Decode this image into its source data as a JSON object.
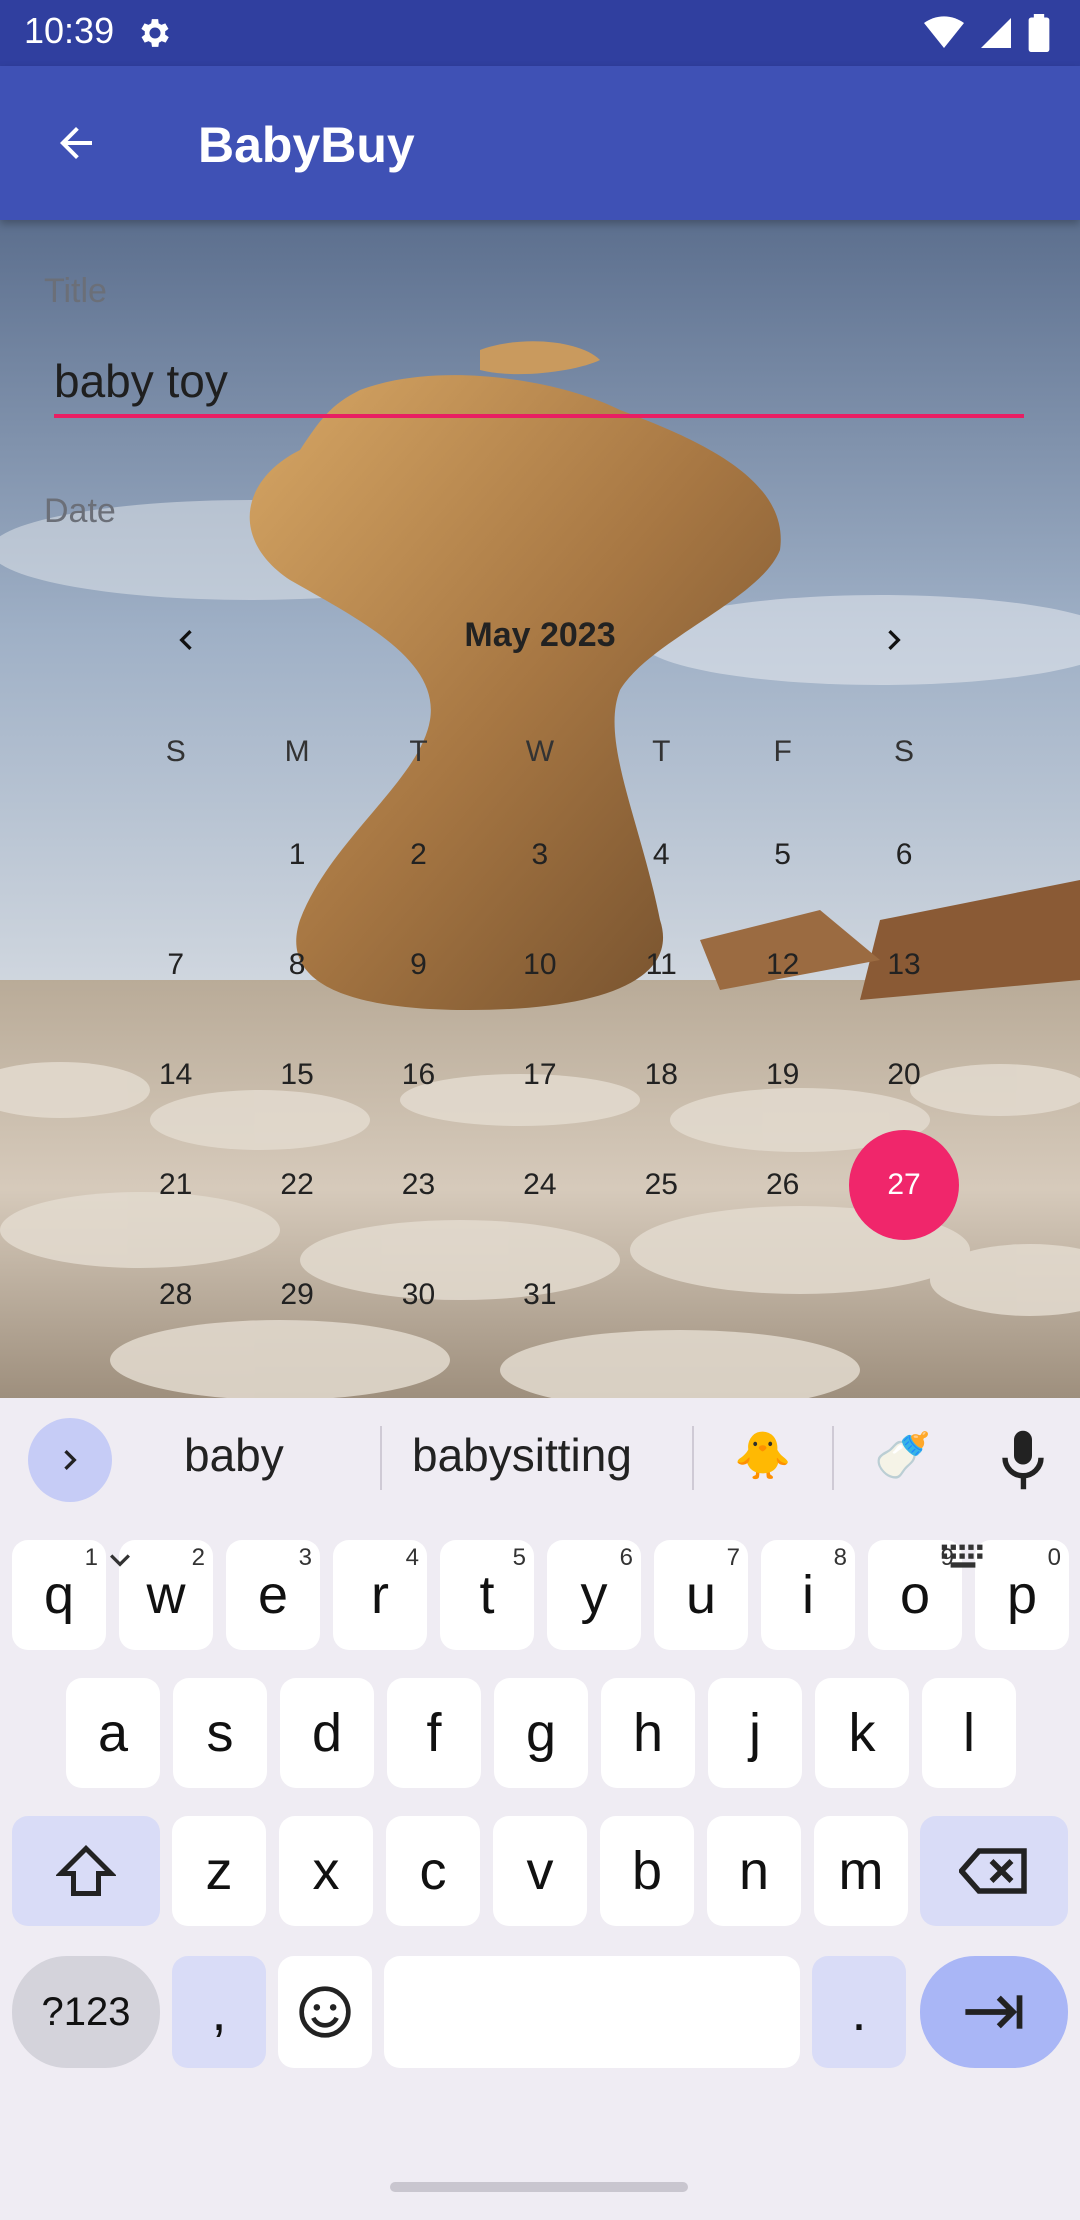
{
  "status": {
    "time": "10:39"
  },
  "app_bar": {
    "title": "BabyBuy"
  },
  "form": {
    "title_label": "Title",
    "title_value": "baby toy",
    "date_label": "Date"
  },
  "calendar": {
    "month": "May 2023",
    "weekdays": [
      "S",
      "M",
      "T",
      "W",
      "T",
      "F",
      "S"
    ],
    "weeks": [
      [
        "",
        "1",
        "2",
        "3",
        "4",
        "5",
        "6"
      ],
      [
        "7",
        "8",
        "9",
        "10",
        "11",
        "12",
        "13"
      ],
      [
        "14",
        "15",
        "16",
        "17",
        "18",
        "19",
        "20"
      ],
      [
        "21",
        "22",
        "23",
        "24",
        "25",
        "26",
        "27"
      ],
      [
        "28",
        "29",
        "30",
        "31",
        "",
        "",
        ""
      ]
    ],
    "selected_day": "27",
    "accent_color": "#f0266b"
  },
  "keyboard": {
    "suggestions": [
      "baby",
      "babysitting",
      "🐥",
      "🍼"
    ],
    "row1": [
      [
        "q",
        "1"
      ],
      [
        "w",
        "2"
      ],
      [
        "e",
        "3"
      ],
      [
        "r",
        "4"
      ],
      [
        "t",
        "5"
      ],
      [
        "y",
        "6"
      ],
      [
        "u",
        "7"
      ],
      [
        "i",
        "8"
      ],
      [
        "o",
        "9"
      ],
      [
        "p",
        "0"
      ]
    ],
    "row2": [
      "a",
      "s",
      "d",
      "f",
      "g",
      "h",
      "j",
      "k",
      "l"
    ],
    "row3": [
      "z",
      "x",
      "c",
      "v",
      "b",
      "n",
      "m"
    ],
    "symbols_label": "?123",
    "comma_label": ",",
    "period_label": "."
  }
}
